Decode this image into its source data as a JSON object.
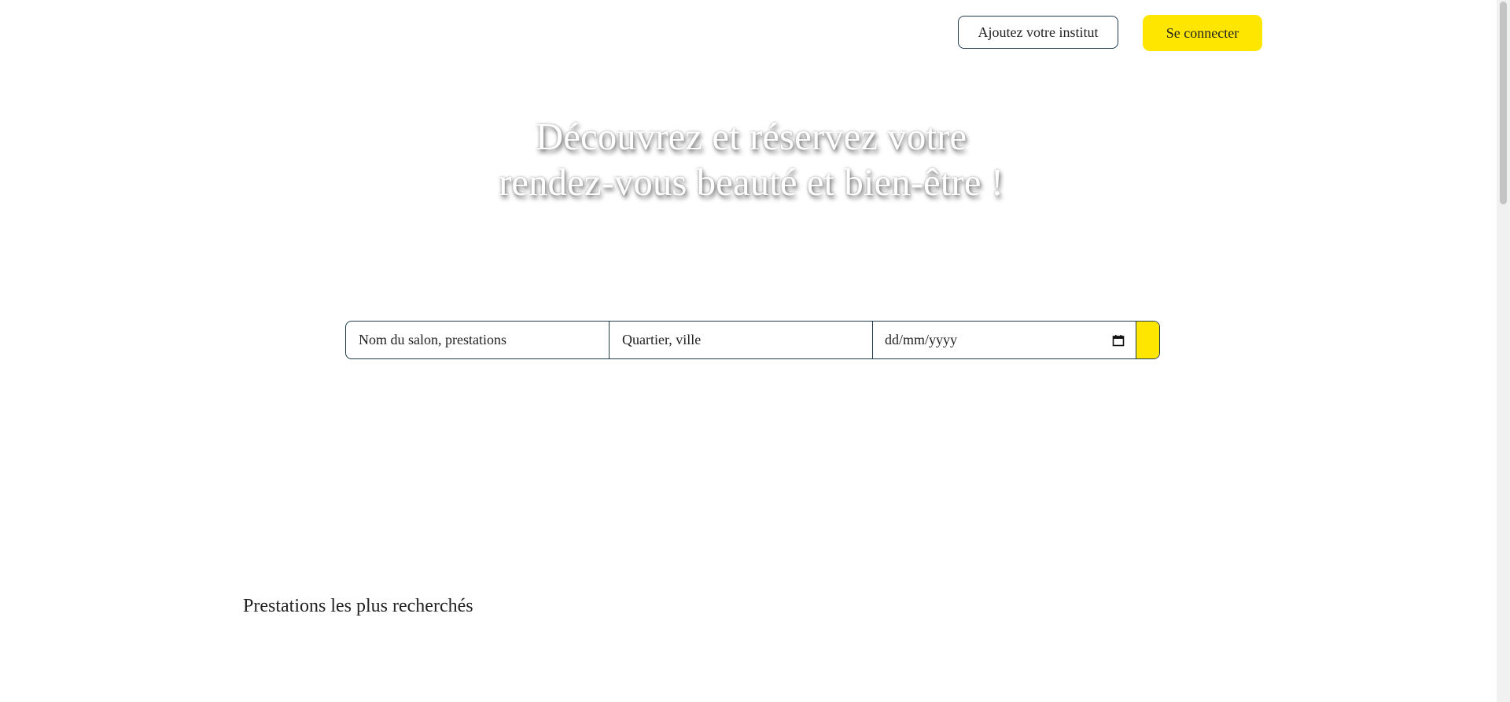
{
  "header": {
    "add_institute_label": "Ajoutez votre institut",
    "login_label": "Se connecter"
  },
  "hero": {
    "title_line1": "Découvrez et réservez votre",
    "title_line2": "rendez-vous beauté et bien-être !"
  },
  "search": {
    "name_placeholder": "Nom du salon, prestations",
    "location_placeholder": "Quartier, ville",
    "date_placeholder": "dd/mm/yyyy",
    "date_icon": "calendar-icon",
    "submit_icon": "search-icon"
  },
  "sections": {
    "popular_title": "Prestations les plus recherchés"
  },
  "colors": {
    "accent": "#ffe600",
    "border": "#1f3b4d",
    "text": "#222222"
  }
}
